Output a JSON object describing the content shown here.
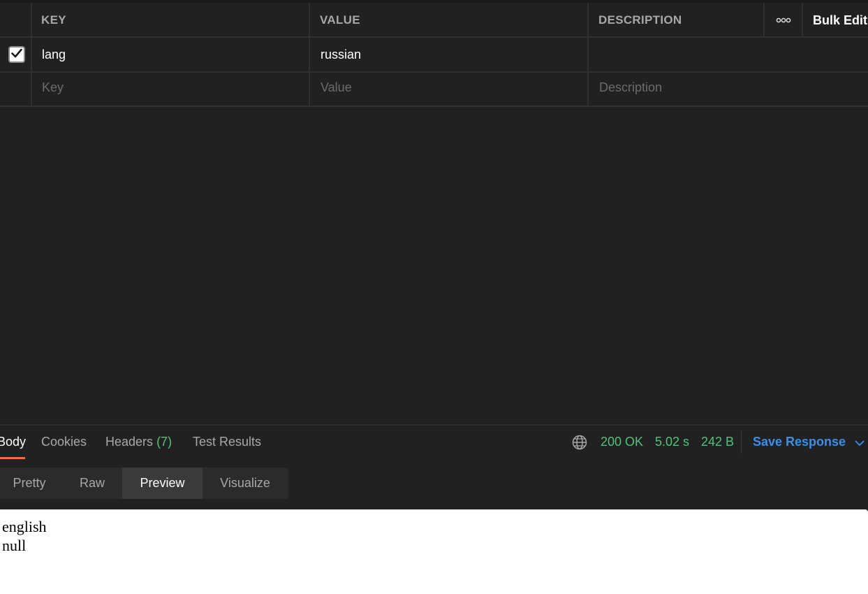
{
  "params_table": {
    "headers": {
      "key": "KEY",
      "value": "VALUE",
      "description": "DESCRIPTION"
    },
    "more_label": "ooo",
    "bulk_edit_label": "Bulk Edit",
    "rows": [
      {
        "checked": true,
        "key": "lang",
        "value": "russian",
        "description": ""
      }
    ],
    "new_row_placeholders": {
      "key": "Key",
      "value": "Value",
      "description": "Description"
    }
  },
  "response": {
    "tabs": [
      {
        "label": "Body",
        "active": true
      },
      {
        "label": "Cookies"
      },
      {
        "label": "Headers"
      },
      {
        "label": "Test Results"
      }
    ],
    "headers_count": "(7)",
    "status": "200 OK",
    "time": "5.02 s",
    "size": "242 B",
    "save_response_label": "Save Response",
    "view_modes": [
      {
        "label": "Pretty"
      },
      {
        "label": "Raw"
      },
      {
        "label": "Preview",
        "active": true
      },
      {
        "label": "Visualize"
      }
    ],
    "preview_lines": [
      "english",
      "null"
    ]
  },
  "colors": {
    "background": "#212121",
    "accent_orange": "#ff6c37",
    "status_green": "#4fc37b",
    "link_blue": "#3d8ee8"
  },
  "icons": [
    "check-icon",
    "more-icon",
    "globe-icon",
    "chevron-down-icon"
  ]
}
